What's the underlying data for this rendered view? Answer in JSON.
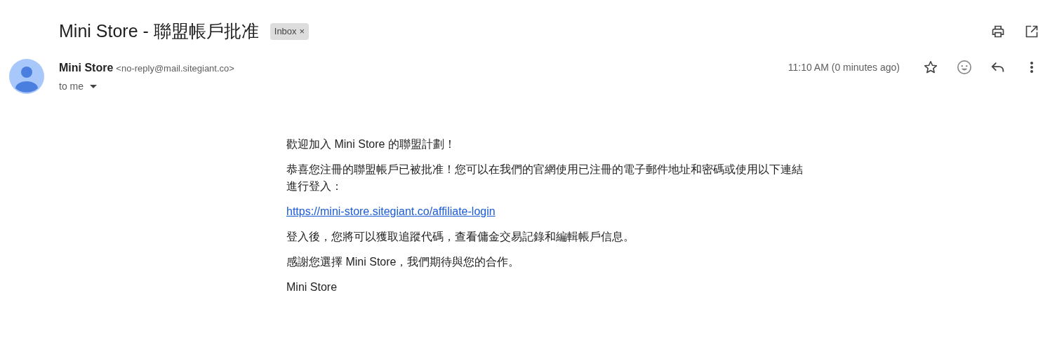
{
  "subject": "Mini Store - 聯盟帳戶批准",
  "label": {
    "text": "Inbox",
    "remove": "×"
  },
  "sender": {
    "name": "Mini Store",
    "email": "<no-reply@mail.sitegiant.co>",
    "recipient": "to me"
  },
  "time": "11:10 AM (0 minutes ago)",
  "starred": false,
  "body": [
    {
      "kind": "text",
      "text": "歡迎加入 Mini Store 的聯盟計劃！"
    },
    {
      "kind": "text",
      "text": "恭喜您注冊的聯盟帳戶已被批准！您可以在我們的官網使用已注冊的電子郵件地址和密碼或使用以下連結進行登入："
    },
    {
      "kind": "link",
      "text": "https://mini-store.sitegiant.co/affiliate-login"
    },
    {
      "kind": "text",
      "text": "登入後，您將可以獲取追蹤代碼，查看傭金交易記錄和編輯帳戶信息。"
    },
    {
      "kind": "text",
      "text": "感謝您選擇 Mini Store，我們期待與您的合作。"
    },
    {
      "kind": "text",
      "text": "Mini Store"
    }
  ]
}
